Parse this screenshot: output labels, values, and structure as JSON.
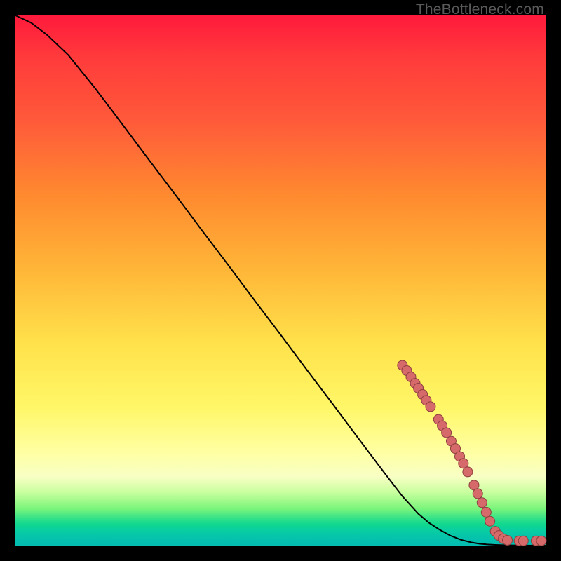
{
  "watermark": "TheBottleneck.com",
  "colors": {
    "background": "#000000",
    "curve": "#000000",
    "marker_fill": "#d66a6a",
    "marker_stroke": "#8f3f3f"
  },
  "chart_data": {
    "type": "line",
    "title": "",
    "xlabel": "",
    "ylabel": "",
    "xlim": [
      0,
      100
    ],
    "ylim": [
      0,
      100
    ],
    "grid": false,
    "legend": false,
    "series": [
      {
        "name": "curve",
        "x": [
          0,
          3,
          6,
          10,
          15,
          20,
          25,
          30,
          35,
          40,
          45,
          50,
          55,
          60,
          65,
          70,
          73,
          76,
          78,
          80,
          82,
          84,
          86,
          87.5,
          89,
          90.5,
          92,
          93.5,
          95,
          96.5,
          98,
          100
        ],
        "y": [
          100,
          98.6,
          96.3,
          92.5,
          86.3,
          79.7,
          73.0,
          66.4,
          59.7,
          53.1,
          46.4,
          39.8,
          33.1,
          26.5,
          19.8,
          13.2,
          9.3,
          6.0,
          4.3,
          3.0,
          1.9,
          1.1,
          0.6,
          0.35,
          0.22,
          0.14,
          0.08,
          0.05,
          0.03,
          0.015,
          0.008,
          0.0
        ]
      }
    ],
    "markers": [
      {
        "x": 73.0,
        "y": 34.0
      },
      {
        "x": 73.8,
        "y": 33.0
      },
      {
        "x": 74.6,
        "y": 31.8
      },
      {
        "x": 75.4,
        "y": 30.6
      },
      {
        "x": 76.0,
        "y": 29.7
      },
      {
        "x": 76.8,
        "y": 28.5
      },
      {
        "x": 77.5,
        "y": 27.4
      },
      {
        "x": 78.3,
        "y": 26.2
      },
      {
        "x": 79.8,
        "y": 23.8
      },
      {
        "x": 80.5,
        "y": 22.6
      },
      {
        "x": 81.3,
        "y": 21.3
      },
      {
        "x": 82.2,
        "y": 19.7
      },
      {
        "x": 83.0,
        "y": 18.3
      },
      {
        "x": 83.8,
        "y": 16.8
      },
      {
        "x": 84.5,
        "y": 15.5
      },
      {
        "x": 85.3,
        "y": 13.9
      },
      {
        "x": 86.5,
        "y": 11.4
      },
      {
        "x": 87.2,
        "y": 9.8
      },
      {
        "x": 88.0,
        "y": 8.1
      },
      {
        "x": 88.8,
        "y": 6.3
      },
      {
        "x": 89.5,
        "y": 4.6
      },
      {
        "x": 90.5,
        "y": 2.7
      },
      {
        "x": 91.2,
        "y": 1.9
      },
      {
        "x": 92.0,
        "y": 1.3
      },
      {
        "x": 92.8,
        "y": 1.0
      },
      {
        "x": 95.0,
        "y": 0.9
      },
      {
        "x": 95.8,
        "y": 0.9
      },
      {
        "x": 98.2,
        "y": 0.9
      },
      {
        "x": 99.2,
        "y": 0.9
      }
    ]
  }
}
